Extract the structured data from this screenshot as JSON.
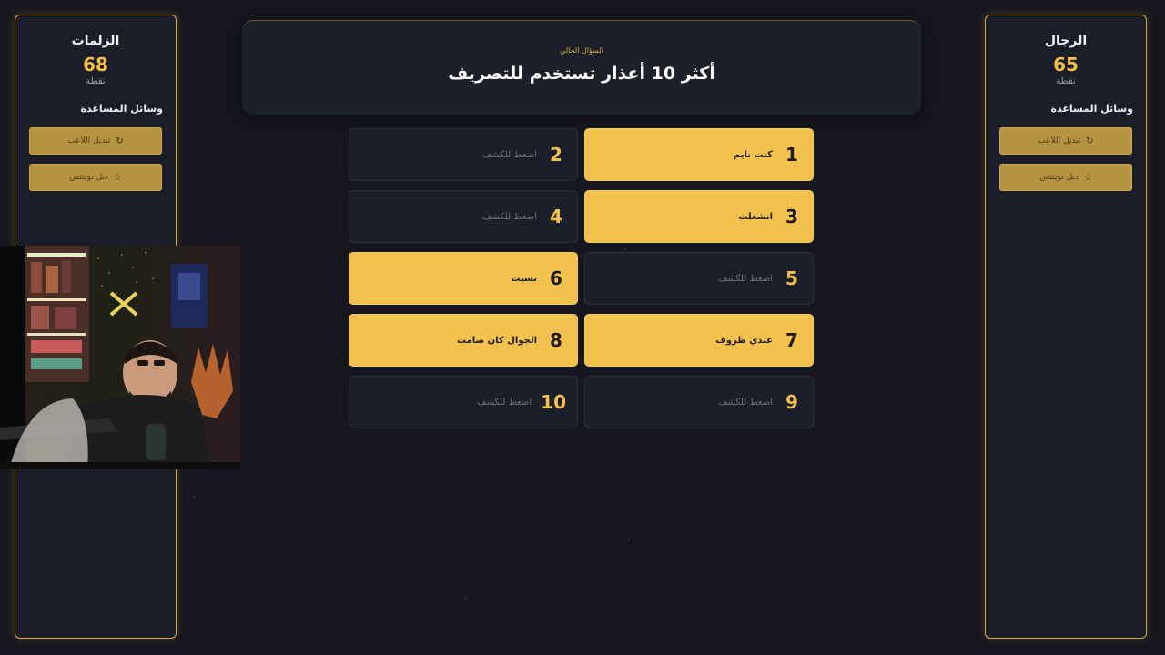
{
  "teams": {
    "left": {
      "name": "الزلمات",
      "score": "68",
      "unit": "نقطة",
      "helpers_title": "وسائل المساعدة",
      "helpers": [
        {
          "label": "تبديل اللاعب",
          "icon": "refresh-icon"
        },
        {
          "label": "دبل بوينتس",
          "icon": "star-icon"
        }
      ]
    },
    "right": {
      "name": "الرجال",
      "score": "65",
      "unit": "نقطة",
      "helpers_title": "وسائل المساعدة",
      "helpers": [
        {
          "label": "تبديل اللاعب",
          "icon": "refresh-icon"
        },
        {
          "label": "دبل بوينتس",
          "icon": "star-icon"
        }
      ]
    }
  },
  "question": {
    "label": "السؤال الحالي",
    "text": "أكثر 10 أعذار تستخدم للتصريف"
  },
  "answers": [
    {
      "number": "1",
      "text": "كنت نايم",
      "revealed": true
    },
    {
      "number": "2",
      "text": "اضغط للكشف",
      "revealed": false
    },
    {
      "number": "3",
      "text": "انشغلت",
      "revealed": true
    },
    {
      "number": "4",
      "text": "اضغط للكشف",
      "revealed": false
    },
    {
      "number": "5",
      "text": "اضغط للكشف",
      "revealed": false
    },
    {
      "number": "6",
      "text": "نسيت",
      "revealed": true
    },
    {
      "number": "7",
      "text": "عندي ظروف",
      "revealed": true
    },
    {
      "number": "8",
      "text": "الجوال كان صامت",
      "revealed": true
    },
    {
      "number": "9",
      "text": "اضغط للكشف",
      "revealed": false
    },
    {
      "number": "10",
      "text": "اضغط للكشف",
      "revealed": false
    }
  ],
  "colors": {
    "accent": "#f2c14e",
    "panel_border": "#d8a73c",
    "background": "#15161e"
  }
}
